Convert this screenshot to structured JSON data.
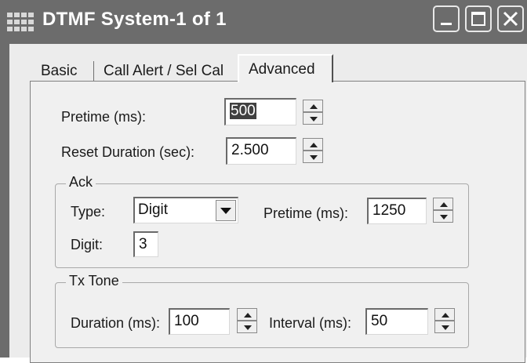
{
  "window": {
    "title": "DTMF System-1 of 1",
    "icons": [
      "app-grid-icon",
      "minimize-icon",
      "maximize-icon",
      "close-icon"
    ]
  },
  "tabs": [
    {
      "label": "Basic",
      "active": false
    },
    {
      "label": "Call Alert / Sel Cal",
      "active": false
    },
    {
      "label": "Advanced",
      "active": true
    }
  ],
  "advanced": {
    "pretime": {
      "label": "Pretime (ms):",
      "value": "500"
    },
    "reset_duration": {
      "label": "Reset Duration (sec):",
      "value": "2.500"
    },
    "ack": {
      "title": "Ack",
      "type_label": "Type:",
      "type_value": "Digit",
      "pretime_label": "Pretime (ms):",
      "pretime_value": "1250",
      "digit_label": "Digit:",
      "digit_value": "3"
    },
    "tx_tone": {
      "title": "Tx Tone",
      "duration_label": "Duration (ms):",
      "duration_value": "100",
      "interval_label": "Interval (ms):",
      "interval_value": "50"
    }
  },
  "colors": {
    "titlebar": "#6c6c6c",
    "panel": "#f0f0f0",
    "selection": "#404040"
  }
}
